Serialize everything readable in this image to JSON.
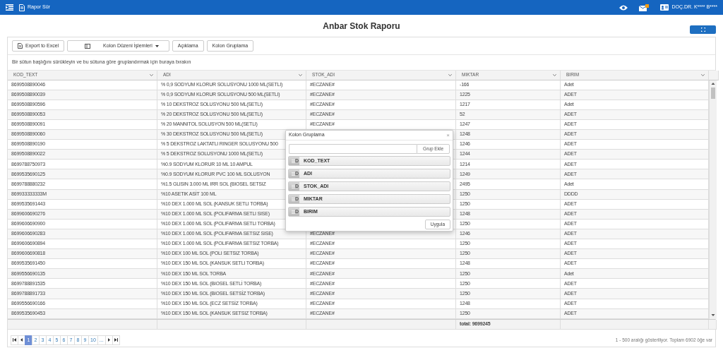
{
  "navbar": {
    "title": "Rapor Sür",
    "user": "DOÇ.DR. K**** B****",
    "mail_badge": true
  },
  "page_title": "Anbar Stok Raporu",
  "toolbar": [
    {
      "label": "Export to Excel",
      "kind": "excel"
    },
    {
      "label": "Kolon Düzeni İşlemleri",
      "kind": "dropdown"
    },
    {
      "label": "Açıklama",
      "kind": "plain"
    },
    {
      "label": "Kolon Gruplama",
      "kind": "plain"
    }
  ],
  "group_hint": "Bir sütun başlığını sürükleyin ve bu sütuna göre gruplandırmak için buraya bırakın",
  "table": {
    "columns": [
      "KOD_TEXT",
      "ADI",
      "STOK_ADI",
      "MIKTAR",
      "BIRIM"
    ],
    "rows": [
      [
        "8699508890046",
        "% 0,9 SODYUM KLORUR SOLUSYONU 1000 ML(SETLI)",
        "#ECZANE#",
        "-166",
        "Adet"
      ],
      [
        "8699508890039",
        "% 0,9 SODYUM KLORUR SOLUSYONU 500 ML(SETLI)",
        "#ECZANE#",
        "1225",
        "ADET"
      ],
      [
        "8699508890596",
        "% 10 DEKSTROZ SOLUSYONU 500 ML(SETLI)",
        "#ECZANE#",
        "1217",
        "Adet"
      ],
      [
        "8699508890053",
        "% 20 DEKSTROZ SOLUSYONU 500 ML(SETLI)",
        "#ECZANE#",
        "52",
        "ADET"
      ],
      [
        "8699508890091",
        "% 20 MANNITOL SOLUSYON 500 ML(SETLI)",
        "#ECZANE#",
        "1247",
        "ADET"
      ],
      [
        "8699508890060",
        "% 30 DEKSTROZ SOLUSYONU 500 ML(SETLI)",
        null,
        "1248",
        "ADET"
      ],
      [
        "8699508890190",
        "% 5 DEKSTROZ LAKTATLI RINGER SOLUSYONU 500",
        null,
        "1246",
        "ADET"
      ],
      [
        "8699508890022",
        "% 5 DEKSTROZ SOLUSYONU 1000 ML(SETLI)",
        null,
        "1244",
        "ADET"
      ],
      [
        "8699788750973",
        "%0.9 SODYUM KLORUR 10 ML 10 AMPUL",
        null,
        "1214",
        "ADET"
      ],
      [
        "8699535690125",
        "%0.9 SODYUM KLORUR PVC 100 ML SOLUSYON",
        null,
        "1249",
        "ADET"
      ],
      [
        "8699788880232",
        "%1.5 GLISIN 3.000 ML IRR SOL (BIOSEL SETSIZ",
        null,
        "2495",
        "Adet"
      ],
      [
        "869933333333M",
        "%10 ASETIK ASİT 100 ML",
        null,
        "1250",
        "DDDD"
      ],
      [
        "8699535691443",
        "%10 DEX 1.000 ML SOL (KANSUK SETLI TORBA)",
        null,
        "1250",
        "ADET"
      ],
      [
        "8699606690276",
        "%10 DEX 1.000 ML SOL (POLIFARMA SETLI SISE)",
        null,
        "1248",
        "ADET"
      ],
      [
        "8699606690900",
        "%10 DEX 1.000 ML SOL (POLIFARMA SETLI TORBA)",
        null,
        "1250",
        "ADET"
      ],
      [
        "8699606690283",
        "%10 DEX 1.000 ML SOL (POLIFARMA SETSIZ SISE)",
        "#ECZANE#",
        "1246",
        "ADET"
      ],
      [
        "8699606690894",
        "%10 DEX 1.000 ML SOL (POLIFARMA SETSIZ TORBA)",
        "#ECZANE#",
        "1250",
        "ADET"
      ],
      [
        "8699606690818",
        "%10 DEX 100 ML SOL (POLI SETSIZ TORBA)",
        "#ECZANE#",
        "1250",
        "ADET"
      ],
      [
        "8699535691450",
        "%10 DEX 150 ML SOL (KANSUK SETLI TORBA)",
        "#ECZANE#",
        "1248",
        "ADET"
      ],
      [
        "8699556690135",
        "%10 DEX 150 ML SOL TORBA",
        "#ECZANE#",
        "1250",
        "Adet"
      ],
      [
        "8699788891535",
        "%10 DEX 150 ML SOL (BIOSEL SETLİ TORBA)",
        "#ECZANE#",
        "1250",
        "ADET"
      ],
      [
        "8699788891733",
        "%10 DEX 150 ML SOL (BIOSEL SETSİZ TORBA)",
        "#ECZANE#",
        "1250",
        "ADET"
      ],
      [
        "8699556690166",
        "%10 DEX 150 ML SOL (ECZ SETSİZ TORBA)",
        "#ECZANE#",
        "1248",
        "ADET"
      ],
      [
        "8699535690453",
        "%10 DEX 150 ML SOL (KANSUK SETSIZ TORBA)",
        "#ECZANE#",
        "1250",
        "ADET"
      ]
    ],
    "total": "total: 9699245"
  },
  "pager": {
    "pages": [
      {
        "label": "1",
        "selected": true
      },
      {
        "label": "2",
        "selected": false
      },
      {
        "label": "3",
        "selected": false
      },
      {
        "label": "4",
        "selected": false
      },
      {
        "label": "5",
        "selected": false
      },
      {
        "label": "6",
        "selected": false
      },
      {
        "label": "7",
        "selected": false
      },
      {
        "label": "8",
        "selected": false
      },
      {
        "label": "9",
        "selected": false
      },
      {
        "label": "10",
        "selected": false
      },
      {
        "label": "...",
        "selected": false
      }
    ],
    "info": "1 - 500 aralığı gösteriliyor. Toplam 6902 öğe var"
  },
  "dialog": {
    "title": "Kolon Gruplama",
    "close": "×",
    "add_button": "Grup Ekle",
    "items": [
      {
        "handle": "D",
        "label": "KOD_TEXT"
      },
      {
        "handle": "D",
        "label": "ADI"
      },
      {
        "handle": "D",
        "label": "STOK_ADI"
      },
      {
        "handle": "D",
        "label": "MIKTAR"
      },
      {
        "handle": "D",
        "label": "BIRIM"
      }
    ],
    "apply_button": "Uygula"
  }
}
